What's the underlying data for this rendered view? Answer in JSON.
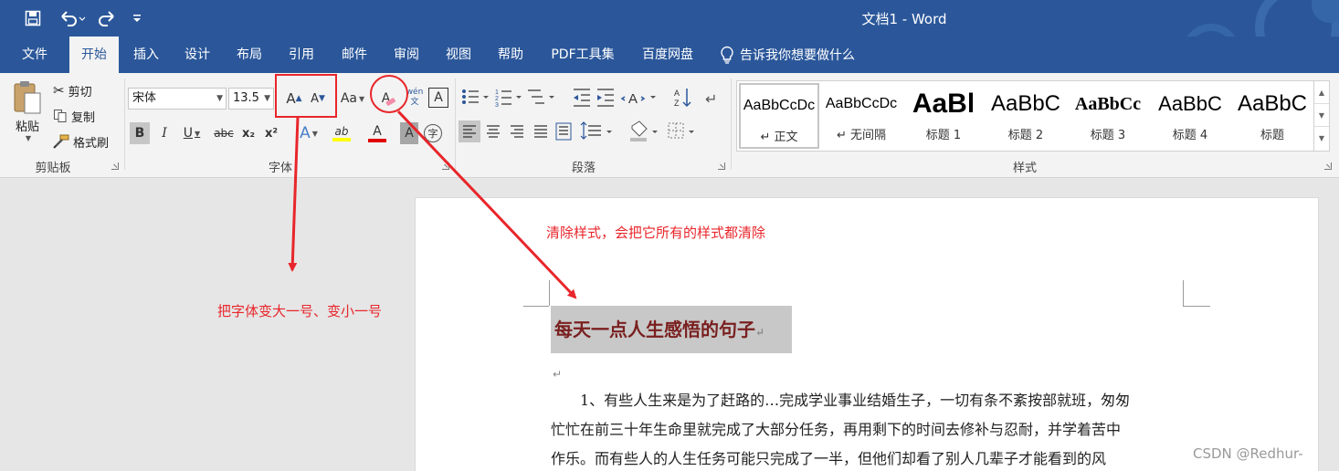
{
  "window": {
    "title": "文档1  -  Word",
    "quick_access": {
      "save": "save-icon",
      "undo": "undo-icon",
      "redo": "redo-icon",
      "customize": "customize-icon"
    }
  },
  "tabs": [
    "文件",
    "开始",
    "插入",
    "设计",
    "布局",
    "引用",
    "邮件",
    "审阅",
    "视图",
    "帮助",
    "PDF工具集",
    "百度网盘"
  ],
  "active_tab": "开始",
  "tell_me": "告诉我你想要做什么",
  "clipboard": {
    "paste": "粘贴",
    "cut": "剪切",
    "copy": "复制",
    "format_painter": "格式刷",
    "label": "剪贴板"
  },
  "font": {
    "family": "宋体",
    "size": "13.5",
    "grow": "A",
    "shrink": "A",
    "change_case": "Aa",
    "clear_format": "A",
    "phonetic": "wén\n文",
    "border_char": "A",
    "bold": "B",
    "italic": "I",
    "underline": "U",
    "strike": "abc",
    "sub": "x₂",
    "sup": "x²",
    "text_effect": "A",
    "highlight": "ab",
    "font_color": "A",
    "char_shading": "A",
    "enclose": "字",
    "label": "字体",
    "colors": {
      "highlight": "#ffff00",
      "font_color": "#e00000"
    }
  },
  "paragraph": {
    "label": "段落"
  },
  "styles": {
    "items": [
      {
        "sample": "AaBbCcDc",
        "name": "↵ 正文"
      },
      {
        "sample": "AaBbCcDc",
        "name": "↵ 无间隔"
      },
      {
        "sample": "AaBl",
        "name": "标题 1"
      },
      {
        "sample": "AaBbC",
        "name": "标题 2"
      },
      {
        "sample": "AaBbCc",
        "name": "标题 3"
      },
      {
        "sample": "AaBbC",
        "name": "标题 4"
      },
      {
        "sample": "AaBbC",
        "name": "标题"
      }
    ],
    "label": "样式"
  },
  "document": {
    "heading": "每天一点人生感悟的句子",
    "heading_mark": "↵",
    "empty_mark": "↵",
    "paragraph_lines": [
      "　　1、有些人生来是为了赶路的…完成学业事业结婚生子，一切有条不紊按部就班，匆匆",
      "忙忙在前三十年生命里就完成了大部分任务，再用剩下的时间去修补与忍耐，并学着苦中",
      "作乐。而有些人的人生任务可能只完成了一半，但他们却看了别人几辈子才能看到的风"
    ]
  },
  "annotations": {
    "clear_style": "清除样式，会把它所有的样式都清除",
    "font_size": "把字体变大一号、变小一号",
    "color": "#e8262b"
  },
  "watermark": "CSDN @Redhur-"
}
